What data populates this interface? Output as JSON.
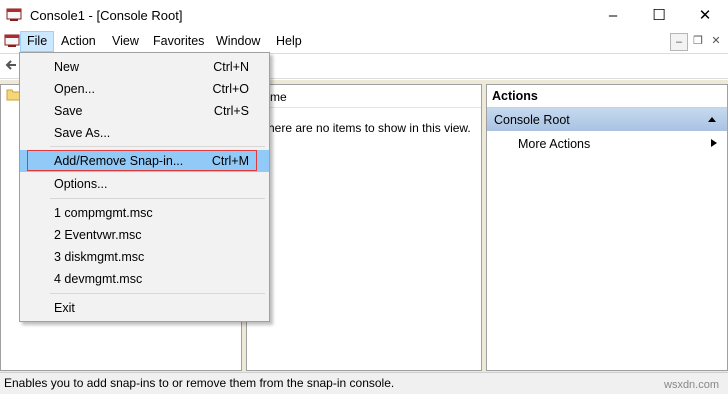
{
  "window": {
    "title": "Console1 - [Console Root]"
  },
  "menubar": {
    "items": [
      "File",
      "Action",
      "View",
      "Favorites",
      "Window",
      "Help"
    ]
  },
  "file_menu": {
    "items": [
      {
        "label": "New",
        "shortcut": "Ctrl+N"
      },
      {
        "label": "Open...",
        "shortcut": "Ctrl+O"
      },
      {
        "label": "Save",
        "shortcut": "Ctrl+S"
      },
      {
        "label": "Save As...",
        "shortcut": ""
      },
      {
        "label": "Add/Remove Snap-in...",
        "shortcut": "Ctrl+M"
      },
      {
        "label": "Options...",
        "shortcut": ""
      },
      {
        "label": "1 compmgmt.msc",
        "shortcut": ""
      },
      {
        "label": "2 Eventvwr.msc",
        "shortcut": ""
      },
      {
        "label": "3 diskmgmt.msc",
        "shortcut": ""
      },
      {
        "label": "4 devmgmt.msc",
        "shortcut": ""
      },
      {
        "label": "Exit",
        "shortcut": ""
      }
    ]
  },
  "list_pane": {
    "column_header": "me",
    "empty_message": "here are no items to show in this view."
  },
  "actions_pane": {
    "title": "Actions",
    "section": "Console Root",
    "more_actions": "More Actions"
  },
  "statusbar": {
    "text": "Enables you to add snap-ins to or remove them from the snap-in console."
  },
  "watermark": "wsxdn.com",
  "colors": {
    "menu_highlight": "#91c9f7",
    "highlight_box": "#e0393c",
    "actions_header": "#b8cfe9"
  }
}
